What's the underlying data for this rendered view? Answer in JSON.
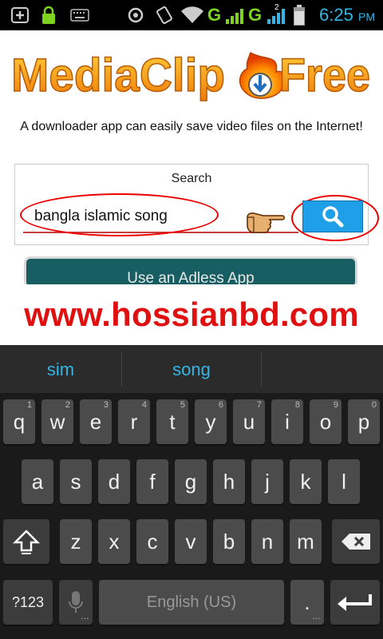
{
  "status_bar": {
    "time": "6:25",
    "ampm": "PM",
    "network_labels": [
      "G",
      "G"
    ],
    "sim_number": "2",
    "icons": [
      "add-icon",
      "lock-icon",
      "keyboard-icon",
      "sync-icon",
      "vibrate-icon",
      "wifi-icon",
      "signal-icon",
      "battery-icon"
    ]
  },
  "app": {
    "logo_text": "MediaClip Free",
    "tagline": "A downloader app can easily save video files on the Internet!",
    "search": {
      "title": "Search",
      "input_value": "bangla islamic song",
      "button_icon": "search-icon"
    },
    "adless_button": "Use an Adless App"
  },
  "watermark": "www.hossianbd.com",
  "keyboard": {
    "suggestions": [
      "sim",
      "song",
      ""
    ],
    "row1": [
      {
        "k": "q",
        "h": "1"
      },
      {
        "k": "w",
        "h": "2"
      },
      {
        "k": "e",
        "h": "3"
      },
      {
        "k": "r",
        "h": "4"
      },
      {
        "k": "t",
        "h": "5"
      },
      {
        "k": "y",
        "h": "6"
      },
      {
        "k": "u",
        "h": "7"
      },
      {
        "k": "i",
        "h": "8"
      },
      {
        "k": "o",
        "h": "9"
      },
      {
        "k": "p",
        "h": "0"
      }
    ],
    "row2": [
      "a",
      "s",
      "d",
      "f",
      "g",
      "h",
      "j",
      "k",
      "l"
    ],
    "row3": [
      "z",
      "x",
      "c",
      "v",
      "b",
      "n",
      "m"
    ],
    "symbols_label": "?123",
    "space_label": "English (US)",
    "period_label": ".",
    "colors": {
      "accent": "#33b5e5",
      "key": "#4b4b4b",
      "background": "#1a1a1a"
    }
  }
}
